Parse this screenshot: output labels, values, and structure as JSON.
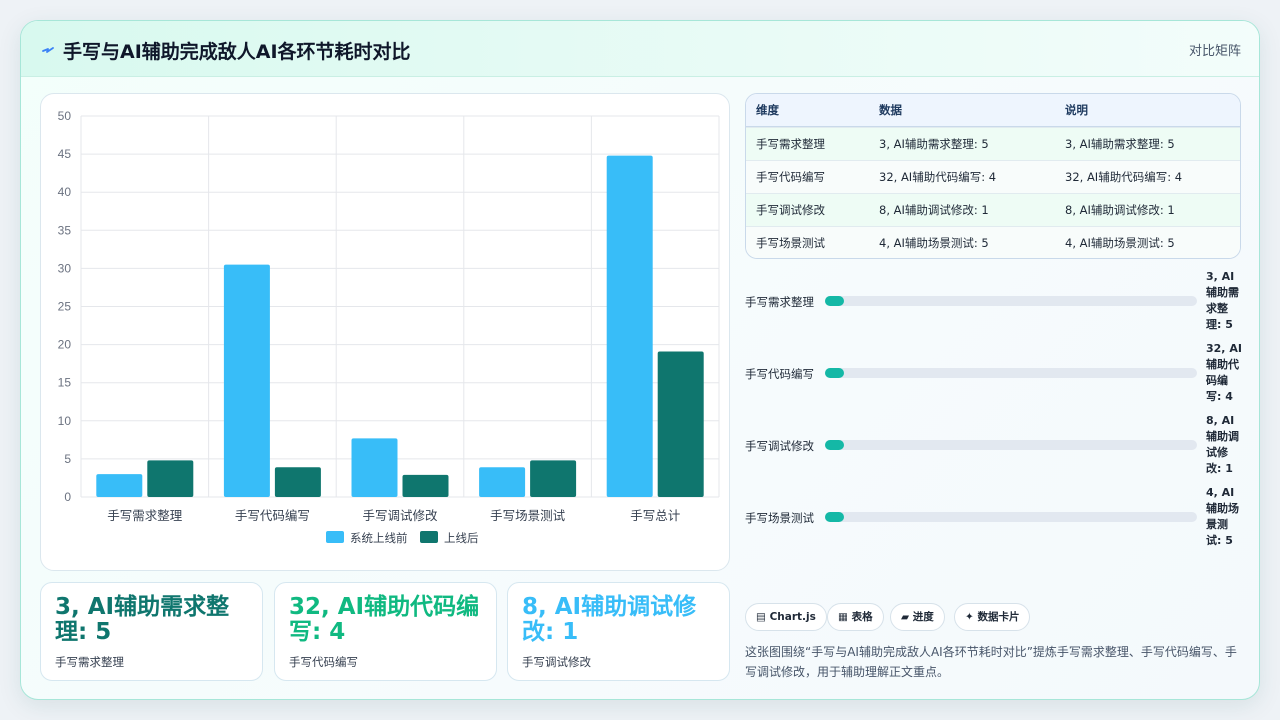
{
  "header": {
    "title": "手写与AI辅助完成敌人AI各环节耗时对比",
    "right_label": "对比矩阵"
  },
  "chart_data": {
    "type": "bar",
    "categories": [
      "手写需求整理",
      "手写代码编写",
      "手写调试修改",
      "手写场景测试",
      "手写总计"
    ],
    "series": [
      {
        "name": "系统上线前",
        "values": [
          3,
          30.5,
          7.7,
          3.9,
          44.8
        ],
        "color": "#38bdf8"
      },
      {
        "name": "上线后",
        "values": [
          4.8,
          3.9,
          2.9,
          4.8,
          19.1
        ],
        "color": "#0f766e"
      }
    ],
    "ylim": [
      0,
      50
    ],
    "yticks": [
      0,
      5,
      10,
      15,
      20,
      25,
      30,
      35,
      40,
      45,
      50
    ],
    "grid": true,
    "legend": "bottom"
  },
  "table": {
    "headers": [
      "维度",
      "数据",
      "说明"
    ],
    "rows": [
      [
        "手写需求整理",
        "3, AI辅助需求整理: 5",
        "3, AI辅助需求整理: 5"
      ],
      [
        "手写代码编写",
        "32, AI辅助代码编写: 4",
        "32, AI辅助代码编写: 4"
      ],
      [
        "手写调试修改",
        "8, AI辅助调试修改: 1",
        "8, AI辅助调试修改: 1"
      ],
      [
        "手写场景测试",
        "4, AI辅助场景测试: 5",
        "4, AI辅助场景测试: 5"
      ]
    ]
  },
  "progress": [
    {
      "label": "手写需求整理",
      "value_text": "3, AI辅助需求整理: 5",
      "fill_fraction": 0.05
    },
    {
      "label": "手写代码编写",
      "value_text": "32, AI辅助代码编写: 4",
      "fill_fraction": 0.05
    },
    {
      "label": "手写调试修改",
      "value_text": "8, AI辅助调试修改: 1",
      "fill_fraction": 0.05
    },
    {
      "label": "手写场景测试",
      "value_text": "4, AI辅助场景测试: 5",
      "fill_fraction": 0.05
    }
  ],
  "stats": [
    {
      "value": "3, AI辅助需求整理: 5",
      "label": "手写需求整理",
      "color": "#0f766e"
    },
    {
      "value": "32, AI辅助代码编写: 4",
      "label": "手写代码编写",
      "color": "#10b981"
    },
    {
      "value": "8, AI辅助调试修改: 1",
      "label": "手写调试修改",
      "color": "#38bdf8"
    }
  ],
  "tags": [
    {
      "icon": "▤",
      "label": "Chart.js"
    },
    {
      "icon": "▦",
      "label": "表格"
    },
    {
      "icon": "▰",
      "label": "进度"
    },
    {
      "icon": "✦",
      "label": "数据卡片"
    }
  ],
  "description": "这张图围绕“手写与AI辅助完成敌人AI各环节耗时对比”提炼手写需求整理、手写代码编写、手写调试修改，用于辅助理解正文重点。"
}
